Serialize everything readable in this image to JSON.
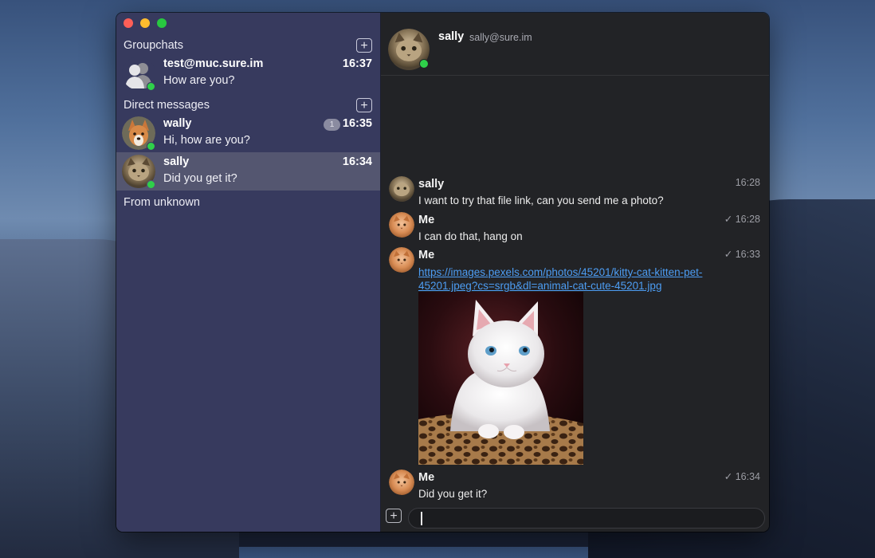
{
  "sidebar": {
    "groupchats_header": "Groupchats",
    "direct_header": "Direct messages",
    "unknown_header": "From unknown",
    "add_icon": "plus-icon",
    "groupchats": [
      {
        "name": "test@muc.sure.im",
        "last_message": "How are you?",
        "time": "16:37",
        "status": "online"
      }
    ],
    "direct": [
      {
        "name": "wally",
        "last_message": "Hi, how are you?",
        "time": "16:35",
        "unread": "1",
        "status": "online"
      },
      {
        "name": "sally",
        "last_message": "Did you get it?",
        "time": "16:34",
        "status": "online",
        "selected": true
      }
    ]
  },
  "chat": {
    "header": {
      "name": "sally",
      "jid": "sally@sure.im",
      "status": "online"
    },
    "messages": [
      {
        "sender": "sally",
        "text": "I want to try that file link, can you send me a photo?",
        "time": "16:28",
        "check": ""
      },
      {
        "sender": "Me",
        "text": "I can do that, hang on",
        "time": "16:28",
        "check": "✓"
      },
      {
        "sender": "Me",
        "link": "https://images.pexels.com/photos/45201/kitty-cat-kitten-pet-45201.jpeg?cs=srgb&dl=animal-cat-cute-45201.jpg",
        "time": "16:33",
        "check": "✓",
        "attachment": "kitten-photo"
      },
      {
        "sender": "Me",
        "text": "Did you get it?",
        "time": "16:34",
        "check": "✓"
      }
    ],
    "composer": {
      "value": "",
      "add_icon": "plus-icon"
    }
  },
  "colors": {
    "sidebar_bg": "#373a5e",
    "selected_row": "#545670",
    "chat_bg": "#222326",
    "link": "#4d9df3",
    "presence": "#2fd04a"
  }
}
